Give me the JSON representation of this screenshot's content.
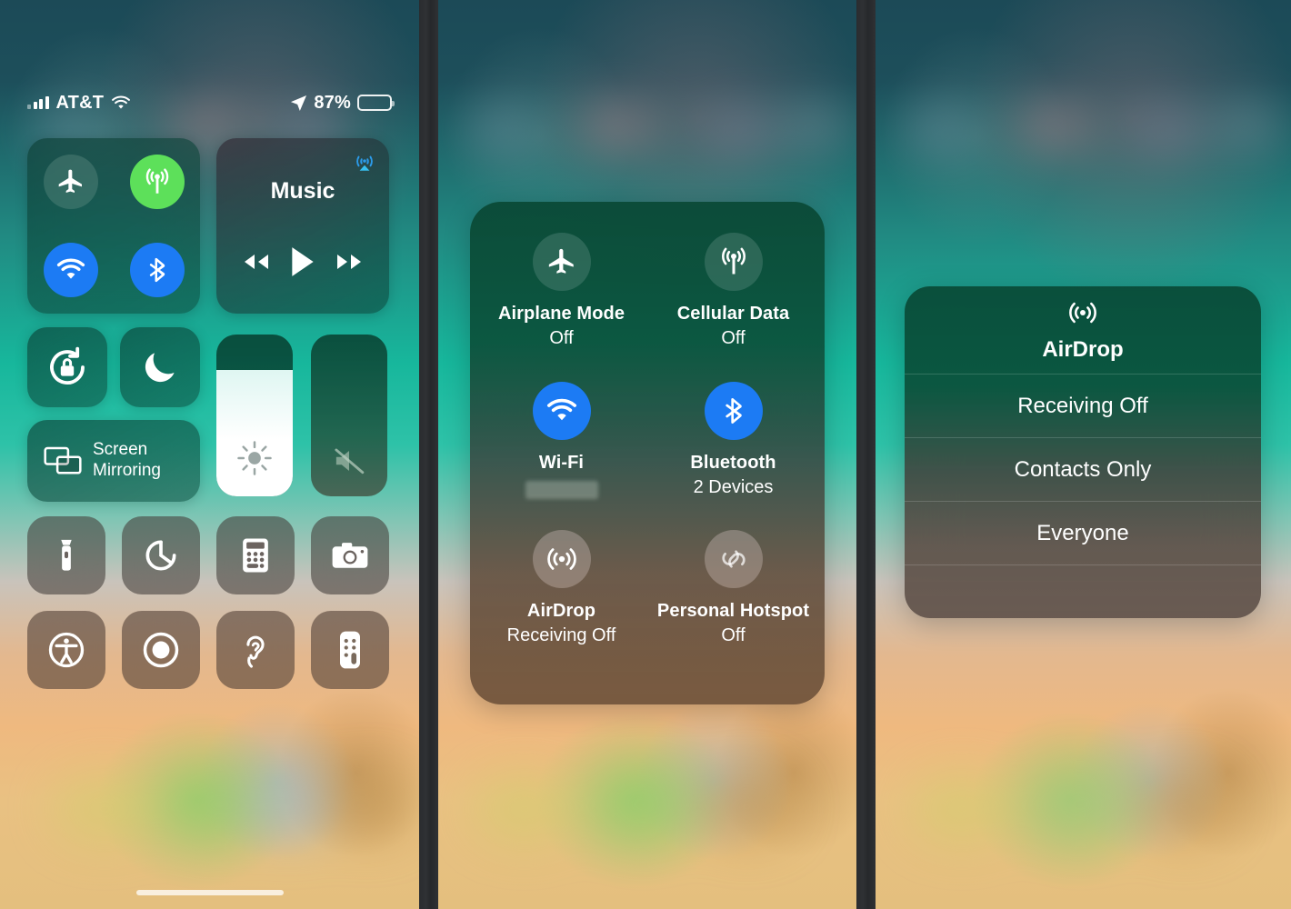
{
  "status_bar": {
    "carrier": "AT&T",
    "battery_percent": "87%",
    "icons": [
      "cellular-signal-icon",
      "wifi-icon",
      "location-arrow-icon",
      "battery-icon"
    ]
  },
  "left_panel": {
    "connectivity": {
      "toggles": [
        {
          "name": "Airplane Mode",
          "icon": "airplane-icon",
          "state": "off",
          "color": "#4f8f80"
        },
        {
          "name": "Cellular Data",
          "icon": "cellular-antenna-icon",
          "state": "on",
          "color": "#5de05a"
        },
        {
          "name": "Wi-Fi",
          "icon": "wifi-icon",
          "state": "on",
          "color": "#1c7bf4"
        },
        {
          "name": "Bluetooth",
          "icon": "bluetooth-icon",
          "state": "on",
          "color": "#1c7bf4"
        }
      ]
    },
    "music": {
      "title": "Music",
      "airplay_icon": "airplay-audio-icon",
      "controls": [
        "rewind-icon",
        "play-icon",
        "fast-forward-icon"
      ]
    },
    "rotation_lock": {
      "label": "Rotation Lock",
      "icon": "rotation-lock-icon"
    },
    "do_not_disturb": {
      "label": "Do Not Disturb",
      "icon": "moon-icon"
    },
    "screen_mirroring": {
      "label_line1": "Screen",
      "label_line2": "Mirroring",
      "icon": "screen-mirroring-icon"
    },
    "brightness": {
      "label": "Brightness",
      "icon": "brightness-sun-icon",
      "value_percent": 78
    },
    "volume": {
      "label": "Volume",
      "icon": "speaker-mute-icon",
      "value_percent": 0
    },
    "apps": [
      {
        "label": "Flashlight",
        "icon": "flashlight-icon"
      },
      {
        "label": "Timer",
        "icon": "timer-icon"
      },
      {
        "label": "Calculator",
        "icon": "calculator-icon"
      },
      {
        "label": "Camera",
        "icon": "camera-icon"
      },
      {
        "label": "Accessibility Shortcuts",
        "icon": "accessibility-icon"
      },
      {
        "label": "Screen Recording",
        "icon": "screen-record-icon"
      },
      {
        "label": "Hearing",
        "icon": "ear-icon"
      },
      {
        "label": "Apple TV Remote",
        "icon": "tv-remote-icon"
      }
    ],
    "home_indicator": "home-indicator"
  },
  "middle_panel": {
    "tiles": [
      {
        "name": "Airplane Mode",
        "state": "Off",
        "icon": "airplane-icon",
        "style": "off"
      },
      {
        "name": "Cellular Data",
        "state": "Off",
        "icon": "cellular-antenna-icon",
        "style": "off"
      },
      {
        "name": "Wi-Fi",
        "state": "",
        "redacted": true,
        "icon": "wifi-icon",
        "style": "blue"
      },
      {
        "name": "Bluetooth",
        "state": "2 Devices",
        "icon": "bluetooth-icon",
        "style": "blue"
      },
      {
        "name": "AirDrop",
        "state": "Receiving Off",
        "icon": "airdrop-icon",
        "style": "dim"
      },
      {
        "name": "Personal Hotspot",
        "state": "Off",
        "icon": "hotspot-icon",
        "style": "dim"
      }
    ]
  },
  "right_panel": {
    "header": {
      "title": "AirDrop",
      "icon": "airdrop-icon"
    },
    "options": [
      {
        "label": "Receiving Off",
        "selected": false
      },
      {
        "label": "Contacts Only",
        "selected": false
      },
      {
        "label": "Everyone",
        "selected": false
      }
    ]
  },
  "colors": {
    "accent_blue": "#1c7bf4",
    "accent_green": "#5de05a",
    "wallpaper_top": "#1c4a57",
    "wallpaper_mid": "#2ec2a8",
    "wallpaper_bottom": "#e4bf7e",
    "divider": "#2c2e31"
  }
}
